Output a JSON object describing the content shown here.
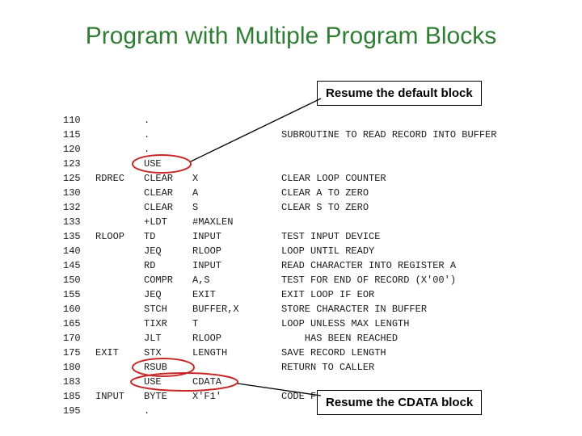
{
  "title": "Program with Multiple Program Blocks",
  "callouts": {
    "top": "Resume the default block",
    "bottom": "Resume the CDATA block"
  },
  "code": [
    {
      "num": "110",
      "lbl": "",
      "op": ".",
      "arg": "",
      "cmt": ""
    },
    {
      "num": "115",
      "lbl": "",
      "op": ".",
      "arg": "",
      "cmt": "SUBROUTINE TO READ RECORD INTO BUFFER"
    },
    {
      "num": "120",
      "lbl": "",
      "op": ".",
      "arg": "",
      "cmt": ""
    },
    {
      "num": "123",
      "lbl": "",
      "op": "USE",
      "arg": "",
      "cmt": ""
    },
    {
      "num": "125",
      "lbl": "RDREC",
      "op": "CLEAR",
      "arg": "X",
      "cmt": "CLEAR LOOP COUNTER"
    },
    {
      "num": "130",
      "lbl": "",
      "op": "CLEAR",
      "arg": "A",
      "cmt": "CLEAR A TO ZERO"
    },
    {
      "num": "132",
      "lbl": "",
      "op": "CLEAR",
      "arg": "S",
      "cmt": "CLEAR S TO ZERO"
    },
    {
      "num": "133",
      "lbl": "",
      "op": "+LDT",
      "arg": "#MAXLEN",
      "cmt": ""
    },
    {
      "num": "135",
      "lbl": "RLOOP",
      "op": "TD",
      "arg": "INPUT",
      "cmt": "TEST INPUT DEVICE"
    },
    {
      "num": "140",
      "lbl": "",
      "op": "JEQ",
      "arg": "RLOOP",
      "cmt": "LOOP UNTIL READY"
    },
    {
      "num": "145",
      "lbl": "",
      "op": "RD",
      "arg": "INPUT",
      "cmt": "READ CHARACTER INTO REGISTER A"
    },
    {
      "num": "150",
      "lbl": "",
      "op": "COMPR",
      "arg": "A,S",
      "cmt": "TEST FOR END OF RECORD (X'00')"
    },
    {
      "num": "155",
      "lbl": "",
      "op": "JEQ",
      "arg": "EXIT",
      "cmt": "EXIT LOOP IF EOR"
    },
    {
      "num": "160",
      "lbl": "",
      "op": "STCH",
      "arg": "BUFFER,X",
      "cmt": "STORE CHARACTER IN BUFFER"
    },
    {
      "num": "165",
      "lbl": "",
      "op": "TIXR",
      "arg": "T",
      "cmt": "LOOP UNLESS MAX LENGTH"
    },
    {
      "num": "170",
      "lbl": "",
      "op": "JLT",
      "arg": "RLOOP",
      "cmt": "    HAS BEEN REACHED"
    },
    {
      "num": "175",
      "lbl": "EXIT",
      "op": "STX",
      "arg": "LENGTH",
      "cmt": "SAVE RECORD LENGTH"
    },
    {
      "num": "180",
      "lbl": "",
      "op": "RSUB",
      "arg": "",
      "cmt": "RETURN TO CALLER"
    },
    {
      "num": "183",
      "lbl": "",
      "op": "USE",
      "arg": "CDATA",
      "cmt": ""
    },
    {
      "num": "185",
      "lbl": "INPUT",
      "op": "BYTE",
      "arg": "X'F1'",
      "cmt": "CODE FOR INPUT DEVICE"
    },
    {
      "num": "195",
      "lbl": "",
      "op": ".",
      "arg": "",
      "cmt": ""
    }
  ]
}
